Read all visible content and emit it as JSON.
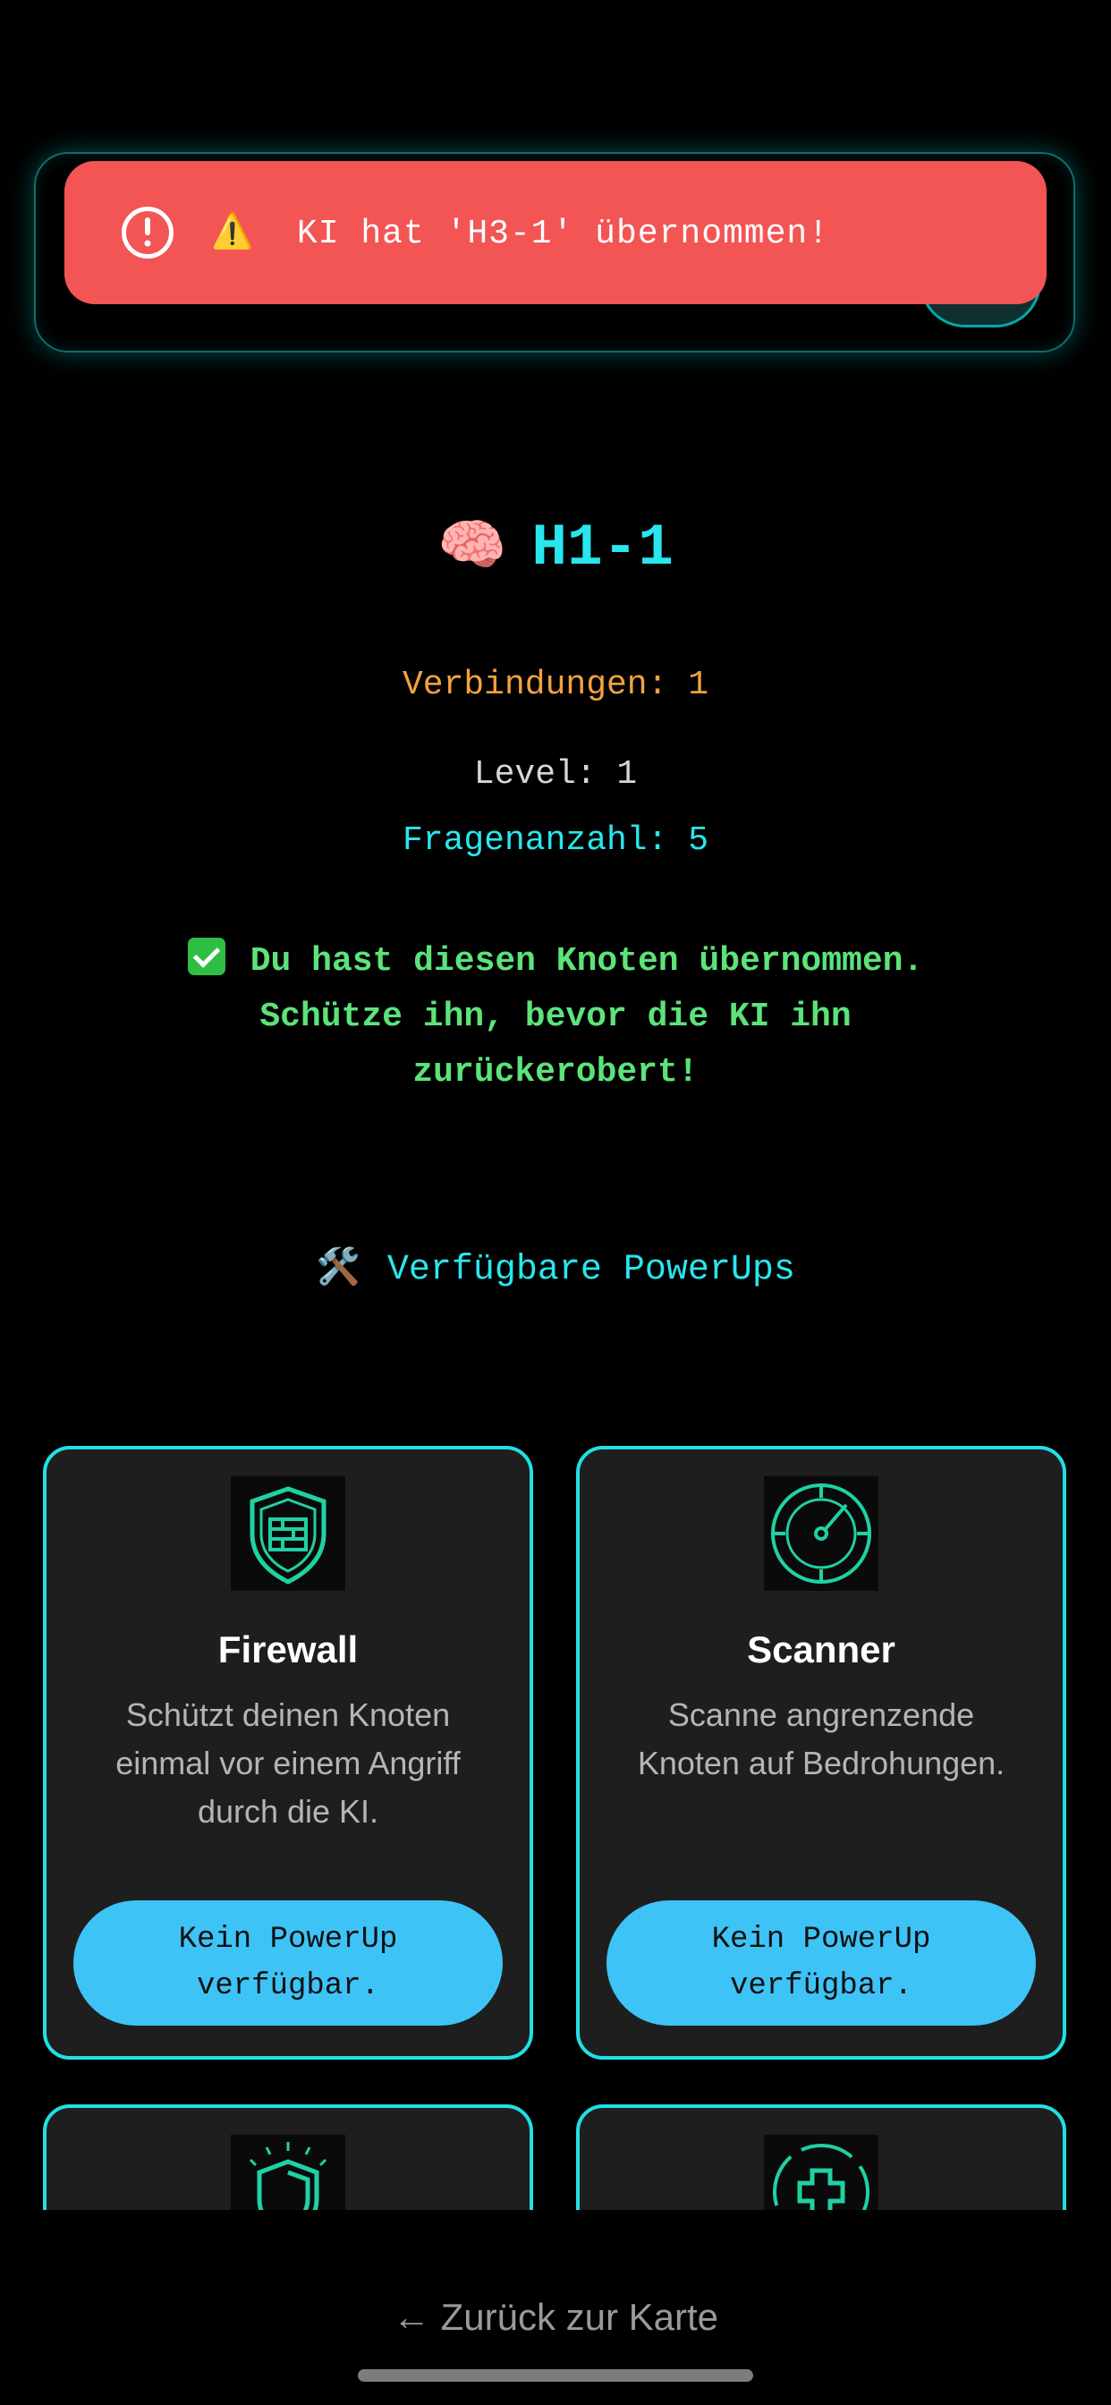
{
  "toast": {
    "message": "⚠️  KI hat 'H3-1' übernommen!",
    "icon": "alert-circle-icon",
    "color": "#f35454"
  },
  "node": {
    "emoji": "🧠",
    "title": "H1-1",
    "connections": "Verbindungen: 1",
    "level": "Level: 1",
    "questions": "Fragenanzahl: 5",
    "owned_message": "Du hast diesen Knoten übernommen. Schütze ihn, bevor die KI ihn zurückerobert!"
  },
  "powerups": {
    "heading": "Verfügbare PowerUps",
    "heading_icon": "🛠️",
    "cards": [
      {
        "icon": "firewall-shield-icon",
        "title": "Firewall",
        "description": "Schützt deinen Knoten einmal vor einem Angriff durch die KI.",
        "button_line1": "Kein PowerUp",
        "button_line2": "verfügbar."
      },
      {
        "icon": "radar-scanner-icon",
        "title": "Scanner",
        "description": "Scanne angrenzende Knoten auf Bedrohungen.",
        "button_line1": "Kein PowerUp",
        "button_line2": "verfügbar."
      },
      {
        "icon": "shield-icon"
      },
      {
        "icon": "heal-cross-icon"
      }
    ]
  },
  "footer": {
    "back_label": "← Zurück zur Karte"
  },
  "colors": {
    "accent": "#29e6ee",
    "orange": "#f3a23e",
    "green": "#5ce37a",
    "button": "#3ec3f7"
  }
}
